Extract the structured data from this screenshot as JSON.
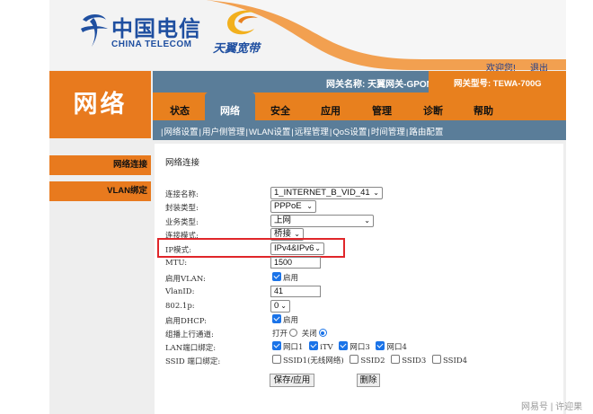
{
  "header": {
    "brand_zh": "中国电信",
    "brand_en": "CHINA TELECOM",
    "sub_brand": "天翼宽带",
    "welcome": "欢迎您!",
    "logout": "退出"
  },
  "gateway": {
    "name": "网关名称:  天翼网关-GPON",
    "model": "网关型号:  TEWA-700G"
  },
  "page_title": "网络",
  "nav": {
    "tabs": [
      "状态",
      "网络",
      "安全",
      "应用",
      "管理",
      "诊断",
      "帮助"
    ],
    "active_index": 1
  },
  "sub_nav": {
    "items": [
      "网络设置",
      "用户侧管理",
      "WLAN设置",
      "远程管理",
      "QoS设置",
      "时间管理",
      "路由配置"
    ],
    "active_index": 0
  },
  "side_menu": {
    "items": [
      "网络连接",
      "VLAN绑定"
    ]
  },
  "form": {
    "section_title": "网络连接",
    "rows": {
      "connection_name": {
        "label": "连接名称:",
        "value": "1_INTERNET_B_VID_41"
      },
      "encap_type": {
        "label": "封装类型:",
        "value": "PPPoE"
      },
      "service_type": {
        "label": "业务类型:",
        "value": "上网"
      },
      "connection_mode": {
        "label": "连接模式:",
        "value": "桥接"
      },
      "ip_mode": {
        "label": "IP模式:",
        "value": "IPv4&IPv6"
      },
      "mtu": {
        "label": "MTU:",
        "value": "1500"
      },
      "enable_vlan": {
        "label": "启用VLAN:",
        "checked": true,
        "text": "启用"
      },
      "vlan_id": {
        "label": "VlanID:",
        "value": "41"
      },
      "p8021p": {
        "label": "802.1p:",
        "value": "0"
      },
      "enable_dhcp": {
        "label": "启用DHCP:",
        "checked": true,
        "text": "启用"
      },
      "multicast_vlan": {
        "label": "组播上行通道:",
        "on_text": "打开",
        "off_text": "关闭",
        "selected": "off"
      },
      "lan_bind": {
        "label": "LAN端口绑定:",
        "options": [
          {
            "text": "网口1",
            "checked": true
          },
          {
            "text": "iTV",
            "checked": true
          },
          {
            "text": "网口3",
            "checked": true
          },
          {
            "text": "网口4",
            "checked": true
          }
        ]
      },
      "ssid_bind": {
        "label": "SSID 端口绑定:",
        "options": [
          {
            "text": "SSID1(无线网络)",
            "checked": false
          },
          {
            "text": "SSID2",
            "checked": false
          },
          {
            "text": "SSID3",
            "checked": false
          },
          {
            "text": "SSID4",
            "checked": false
          }
        ]
      }
    },
    "save_label": "保存/应用",
    "delete_label": "删除"
  },
  "watermark": "网易号 | 许迎果",
  "colors": {
    "orange": "#e87a1e",
    "steel_blue": "#5a7d99",
    "brand_blue": "#1f4fa0",
    "highlight_red": "#e0262a"
  }
}
